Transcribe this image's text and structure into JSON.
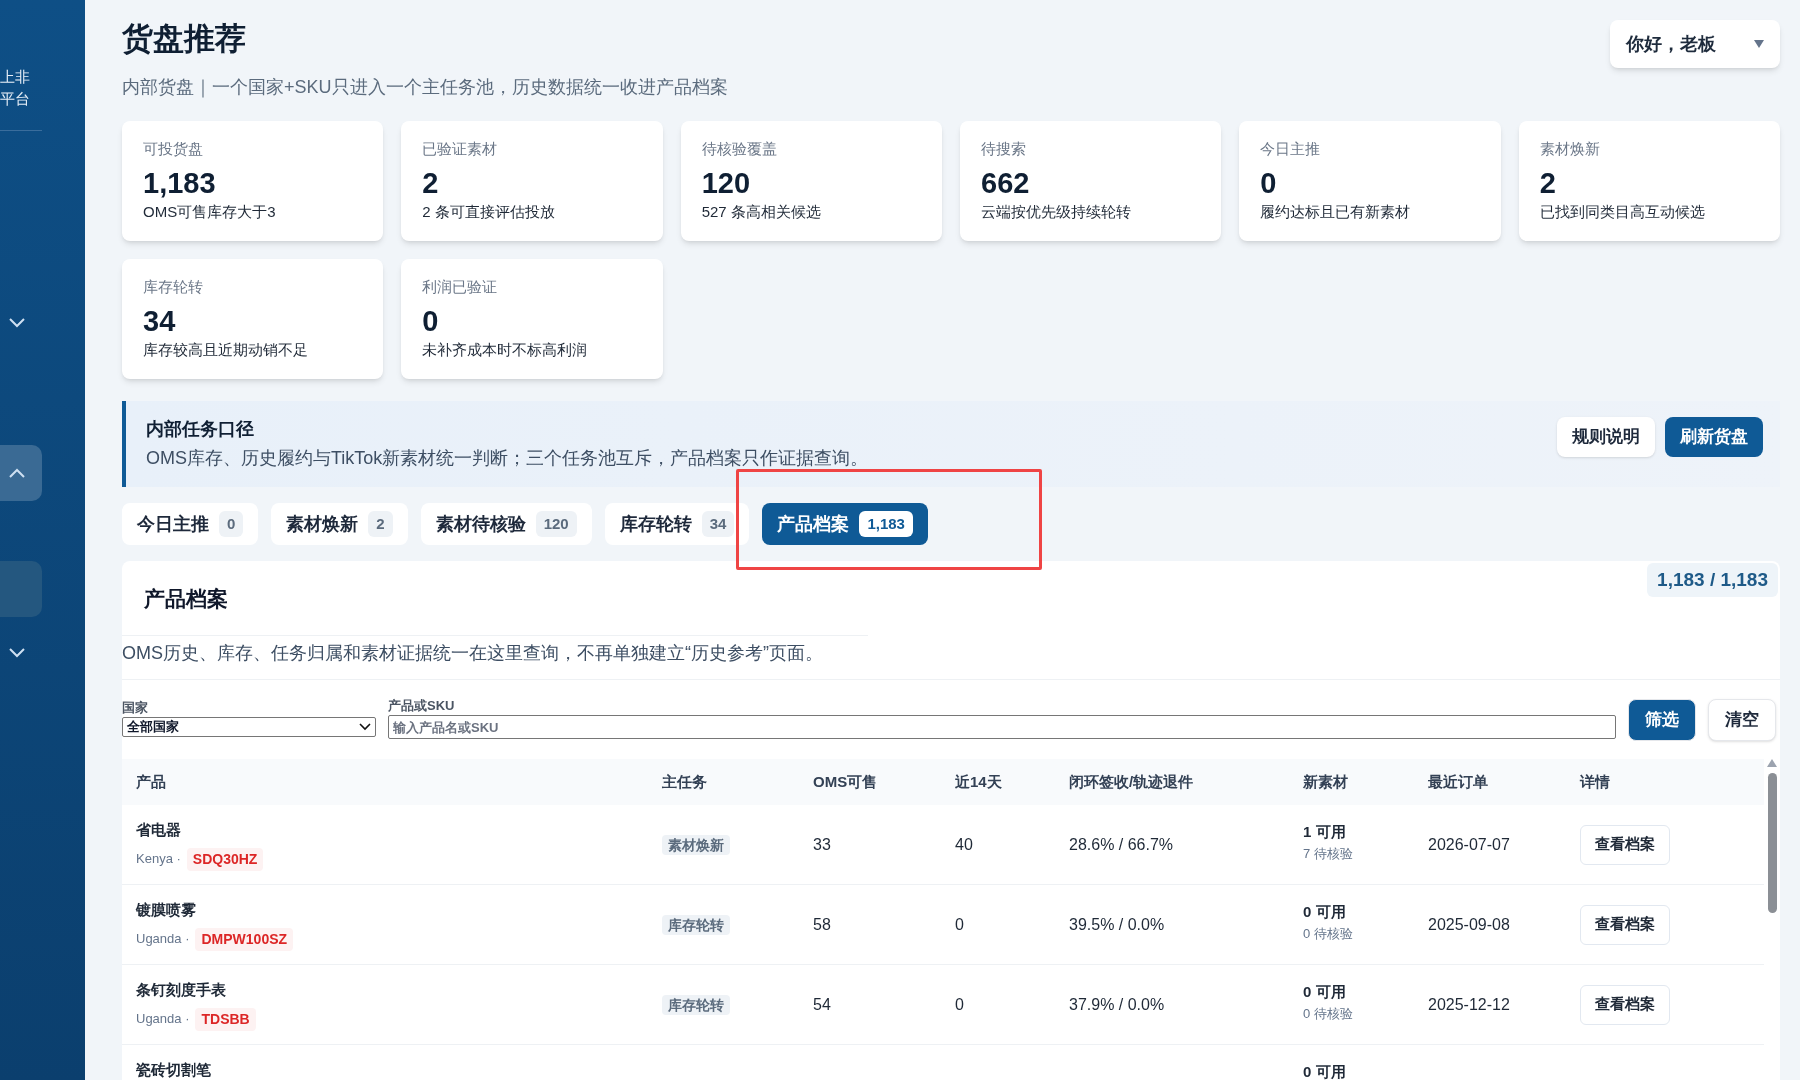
{
  "sidebar": {
    "brand_lines": [
      "上非",
      "平台"
    ],
    "items": [
      {
        "kind": "chevron",
        "expanded": false
      },
      {
        "kind": "block",
        "expanded": true,
        "selected": true
      },
      {
        "kind": "block",
        "selected": false
      },
      {
        "kind": "chevron",
        "expanded": false
      }
    ]
  },
  "header": {
    "title": "货盘推荐",
    "subtitle": "内部货盘｜一个国家+SKU只进入一个主任务池，历史数据统一收进产品档案",
    "user_menu": "你好，老板"
  },
  "stats": [
    {
      "label": "可投货盘",
      "value": "1,183",
      "note": "OMS可售库存大于3"
    },
    {
      "label": "已验证素材",
      "value": "2",
      "note": "2 条可直接评估投放"
    },
    {
      "label": "待核验覆盖",
      "value": "120",
      "note": "527 条高相关候选"
    },
    {
      "label": "待搜索",
      "value": "662",
      "note": "云端按优先级持续轮转"
    },
    {
      "label": "今日主推",
      "value": "0",
      "note": "履约达标且已有新素材"
    },
    {
      "label": "素材焕新",
      "value": "2",
      "note": "已找到同类目高互动候选"
    },
    {
      "label": "库存轮转",
      "value": "34",
      "note": "库存较高且近期动销不足"
    },
    {
      "label": "利润已验证",
      "value": "0",
      "note": "未补齐成本时不标高利润"
    }
  ],
  "notice": {
    "title": "内部任务口径",
    "text": "OMS库存、历史履约与TikTok新素材统一判断；三个任务池互斥，产品档案只作证据查询。",
    "buttons": [
      {
        "label": "规则说明",
        "kind": "secondary"
      },
      {
        "label": "刷新货盘",
        "kind": "primary"
      }
    ]
  },
  "tabs": [
    {
      "label": "今日主推",
      "count": "0",
      "selected": false
    },
    {
      "label": "素材焕新",
      "count": "2",
      "selected": false
    },
    {
      "label": "素材待核验",
      "count": "120",
      "selected": false
    },
    {
      "label": "库存轮转",
      "count": "34",
      "selected": false
    },
    {
      "label": "产品档案",
      "count": "1,183",
      "selected": true
    }
  ],
  "panel": {
    "title": "产品档案",
    "count": "1,183 / 1,183",
    "description": "OMS历史、库存、任务归属和素材证据统一在这里查询，不再单独建立“历史参考”页面。",
    "filters": {
      "country_label": "国家",
      "country_value": "全部国家",
      "query_label": "产品或SKU",
      "query_placeholder": "输入产品名或SKU",
      "buttons": [
        {
          "label": "筛选",
          "kind": "primary"
        },
        {
          "label": "清空",
          "kind": "secondary"
        }
      ]
    },
    "table": {
      "columns": [
        "产品",
        "主任务",
        "OMS可售",
        "近14天",
        "闭环签收/轨迹退件",
        "新素材",
        "最近订单",
        "详情"
      ],
      "rows": [
        {
          "product": "省电器",
          "country": "Kenya ·",
          "sku": "SDQ30HZ",
          "task": "素材焕新",
          "oms": "33",
          "d14": "40",
          "rate": "28.6% / 66.7%",
          "available": "1 可用",
          "pending": "7 待核验",
          "last_order": "2026-07-07",
          "action": "查看档案"
        },
        {
          "product": "镀膜喷雾",
          "country": "Uganda ·",
          "sku": "DMPW100SZ",
          "task": "库存轮转",
          "oms": "58",
          "d14": "0",
          "rate": "39.5% / 0.0%",
          "available": "0 可用",
          "pending": "0 待核验",
          "last_order": "2025-09-08",
          "action": "查看档案"
        },
        {
          "product": "条钉刻度手表",
          "country": "Uganda ·",
          "sku": "TDSBB",
          "task": "库存轮转",
          "oms": "54",
          "d14": "0",
          "rate": "37.9% / 0.0%",
          "available": "0 可用",
          "pending": "0 待核验",
          "last_order": "2025-12-12",
          "action": "查看档案"
        },
        {
          "product": "瓷砖切割笔",
          "available": "0 可用"
        }
      ]
    }
  }
}
